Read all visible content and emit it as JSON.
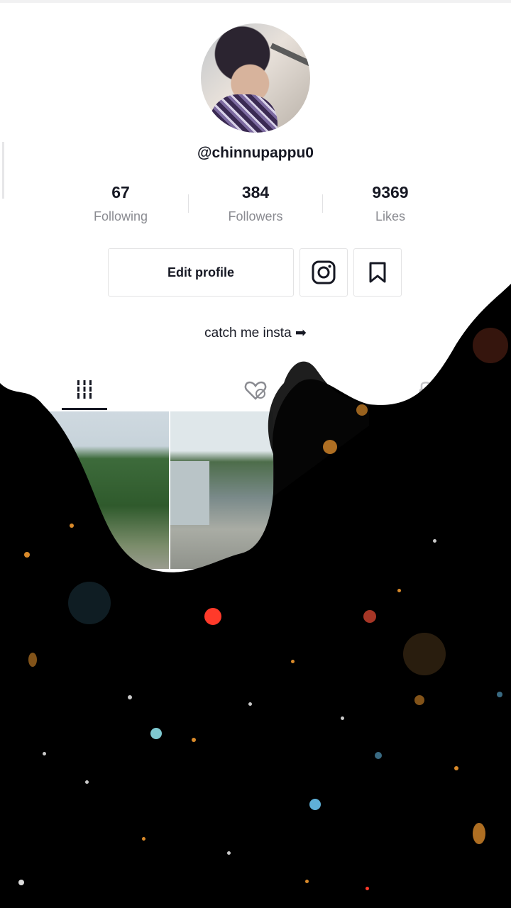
{
  "profile": {
    "username": "@chinnupappu0",
    "bio": "catch me insta ➡"
  },
  "stats": [
    {
      "value": "67",
      "label": "Following"
    },
    {
      "value": "384",
      "label": "Followers"
    },
    {
      "value": "9369",
      "label": "Likes"
    }
  ],
  "buttons": {
    "edit_profile": "Edit profile",
    "instagram_icon": "instagram-icon",
    "bookmark_icon": "bookmark-icon"
  },
  "tabs": [
    {
      "icon": "grid-icon",
      "active": true
    },
    {
      "icon": "liked-hidden-icon",
      "active": false
    },
    {
      "icon": "lock-icon",
      "active": false
    }
  ],
  "colors": {
    "text": "#161823",
    "muted": "#8a8b91",
    "border": "#e3e3e4"
  }
}
